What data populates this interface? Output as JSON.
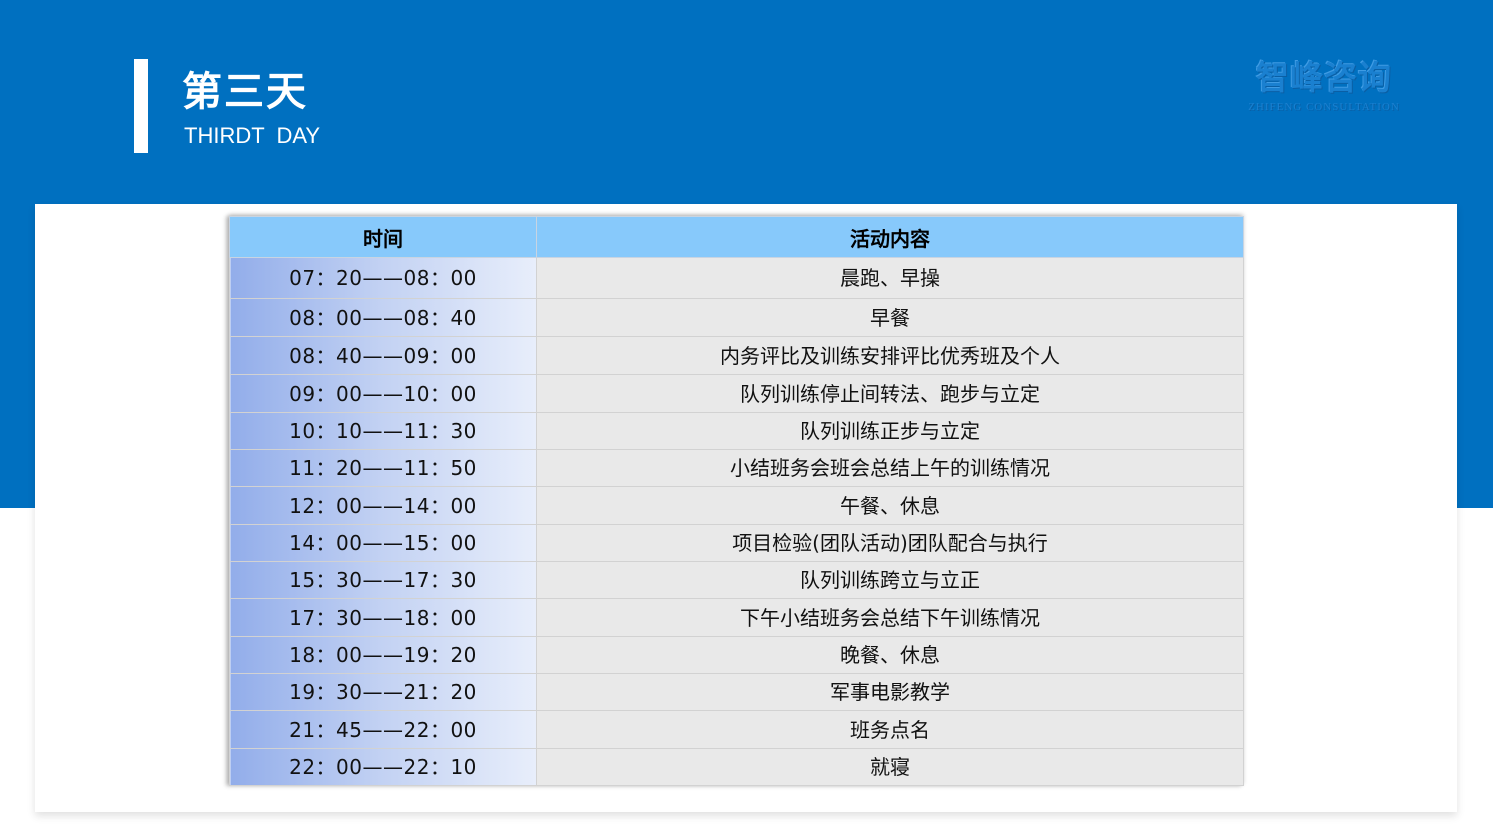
{
  "header": {
    "title_cn": "第三天",
    "title_en": "THIRDT  DAY"
  },
  "logo": {
    "text_cn": "智峰咨询",
    "text_en": "ZHIFENG CONSULTATION"
  },
  "colors": {
    "banner": "#0070c0",
    "table_header": "#87c9fb",
    "row_background": "#e9e9e9"
  },
  "table": {
    "headers": [
      "时间",
      "活动内容"
    ],
    "rows": [
      {
        "time": "07：20——08：00",
        "activity": "晨跑、早操"
      },
      {
        "time": "08：00——08：40",
        "activity": "早餐"
      },
      {
        "time": "08：40——09：00",
        "activity": "内务评比及训练安排评比优秀班及个人"
      },
      {
        "time": "09：00——10：00",
        "activity": "队列训练停止间转法、跑步与立定"
      },
      {
        "time": "10：10——11：30",
        "activity": "队列训练正步与立定"
      },
      {
        "time": "11：20——11：50",
        "activity": "小结班务会班会总结上午的训练情况"
      },
      {
        "time": "12：00——14：00",
        "activity": "午餐、休息"
      },
      {
        "time": "14：00——15：00",
        "activity": "项目检验(团队活动)团队配合与执行"
      },
      {
        "time": "15：30——17：30",
        "activity": "队列训练跨立与立正"
      },
      {
        "time": "17：30——18：00",
        "activity": "下午小结班务会总结下午训练情况"
      },
      {
        "time": "18：00——19：20",
        "activity": "晚餐、休息"
      },
      {
        "time": "19：30——21：20",
        "activity": "军事电影教学"
      },
      {
        "time": "21：45——22：00",
        "activity": "班务点名"
      },
      {
        "time": "22：00——22：10",
        "activity": "就寝"
      }
    ]
  }
}
